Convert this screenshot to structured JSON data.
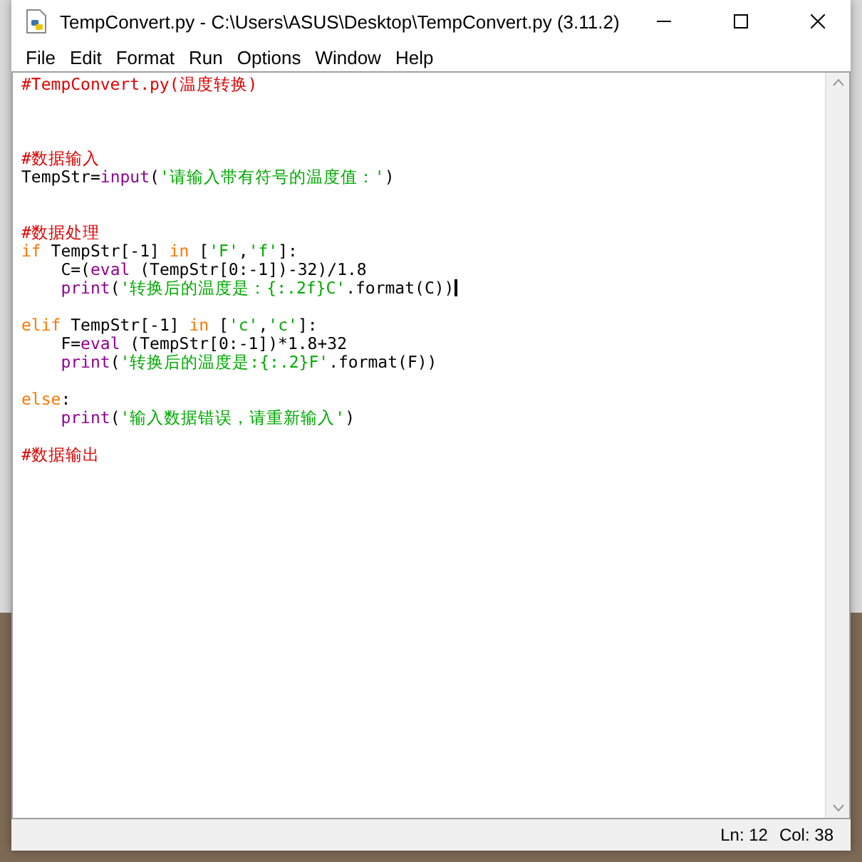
{
  "window": {
    "title": "TempConvert.py - C:\\Users\\ASUS\\Desktop\\TempConvert.py (3.11.2)"
  },
  "menu": [
    {
      "label": "File"
    },
    {
      "label": "Edit"
    },
    {
      "label": "Format"
    },
    {
      "label": "Run"
    },
    {
      "label": "Options"
    },
    {
      "label": "Window"
    },
    {
      "label": "Help"
    }
  ],
  "editor": {
    "lines": [
      {
        "kind": "code",
        "cursor": false,
        "tokens": [
          {
            "kind": "comment",
            "text": "#TempConvert.py(温度转换)"
          }
        ]
      },
      {
        "kind": "blank"
      },
      {
        "kind": "blank"
      },
      {
        "kind": "blank"
      },
      {
        "kind": "code",
        "cursor": false,
        "tokens": [
          {
            "kind": "comment",
            "text": "#数据输入"
          }
        ]
      },
      {
        "kind": "code",
        "cursor": false,
        "tokens": [
          {
            "kind": "plain",
            "text": "TempStr="
          },
          {
            "kind": "builtin",
            "text": "input"
          },
          {
            "kind": "plain",
            "text": "("
          },
          {
            "kind": "string",
            "text": "'请输入带有符号的温度值：'"
          },
          {
            "kind": "plain",
            "text": ")"
          }
        ]
      },
      {
        "kind": "blank"
      },
      {
        "kind": "blank"
      },
      {
        "kind": "code",
        "cursor": false,
        "tokens": [
          {
            "kind": "comment",
            "text": "#数据处理"
          }
        ]
      },
      {
        "kind": "code",
        "cursor": false,
        "tokens": [
          {
            "kind": "keyword",
            "text": "if"
          },
          {
            "kind": "plain",
            "text": " TempStr[-1] "
          },
          {
            "kind": "keyword",
            "text": "in"
          },
          {
            "kind": "plain",
            "text": " ["
          },
          {
            "kind": "string",
            "text": "'F'"
          },
          {
            "kind": "plain",
            "text": ","
          },
          {
            "kind": "string",
            "text": "'f'"
          },
          {
            "kind": "plain",
            "text": "]:"
          }
        ]
      },
      {
        "kind": "code",
        "cursor": false,
        "indented": true,
        "tokens": [
          {
            "kind": "plain",
            "text": "C=("
          },
          {
            "kind": "builtin",
            "text": "eval"
          },
          {
            "kind": "plain",
            "text": " (TempStr[0:-1])-32)/1.8"
          }
        ]
      },
      {
        "kind": "code",
        "cursor": true,
        "indented": true,
        "tokens": [
          {
            "kind": "builtin",
            "text": "print"
          },
          {
            "kind": "plain",
            "text": "("
          },
          {
            "kind": "string",
            "text": "'转换后的温度是：{:.2f}C'"
          },
          {
            "kind": "plain",
            "text": ".format(C))"
          }
        ]
      },
      {
        "kind": "blank"
      },
      {
        "kind": "code",
        "cursor": false,
        "tokens": [
          {
            "kind": "keyword",
            "text": "elif"
          },
          {
            "kind": "plain",
            "text": " TempStr[-1] "
          },
          {
            "kind": "keyword",
            "text": "in"
          },
          {
            "kind": "plain",
            "text": " ["
          },
          {
            "kind": "string",
            "text": "'c'"
          },
          {
            "kind": "plain",
            "text": ","
          },
          {
            "kind": "string",
            "text": "'c'"
          },
          {
            "kind": "plain",
            "text": "]:"
          }
        ]
      },
      {
        "kind": "code",
        "cursor": false,
        "indented": true,
        "tokens": [
          {
            "kind": "plain",
            "text": "F="
          },
          {
            "kind": "builtin",
            "text": "eval"
          },
          {
            "kind": "plain",
            "text": " (TempStr[0:-1])*1.8+32"
          }
        ]
      },
      {
        "kind": "code",
        "cursor": false,
        "indented": true,
        "tokens": [
          {
            "kind": "builtin",
            "text": "print"
          },
          {
            "kind": "plain",
            "text": "("
          },
          {
            "kind": "string",
            "text": "'转换后的温度是:{:.2}F'"
          },
          {
            "kind": "plain",
            "text": ".format(F))"
          }
        ]
      },
      {
        "kind": "blank"
      },
      {
        "kind": "code",
        "cursor": false,
        "tokens": [
          {
            "kind": "keyword",
            "text": "else"
          },
          {
            "kind": "plain",
            "text": ":"
          }
        ]
      },
      {
        "kind": "code",
        "cursor": false,
        "indented": true,
        "tokens": [
          {
            "kind": "builtin",
            "text": "print"
          },
          {
            "kind": "plain",
            "text": "("
          },
          {
            "kind": "string",
            "text": "'输入数据错误，请重新输入'"
          },
          {
            "kind": "plain",
            "text": ")"
          }
        ]
      },
      {
        "kind": "blank"
      },
      {
        "kind": "code",
        "cursor": false,
        "tokens": [
          {
            "kind": "comment",
            "text": "#数据输出"
          }
        ]
      }
    ]
  },
  "status_bar": {
    "line": "Ln: 12",
    "column": "Col: 38"
  }
}
